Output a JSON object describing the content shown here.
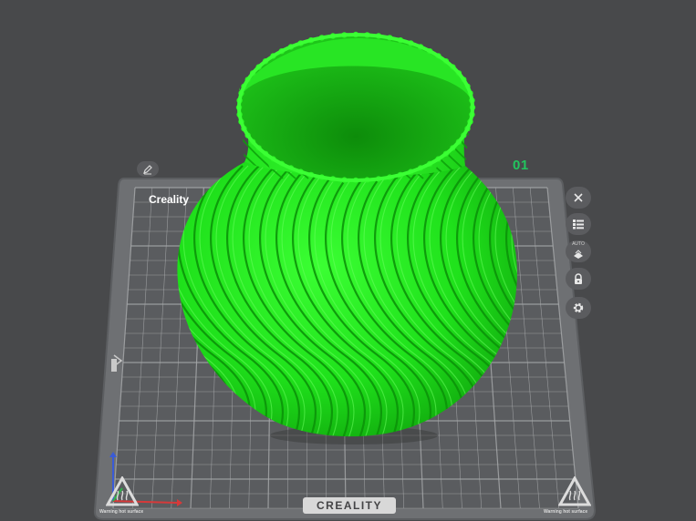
{
  "plate": {
    "brand_top": "Creality",
    "brand_bottom": "CREALITY",
    "number": "01",
    "warning_left": "Warning hot surface",
    "warning_right": "Warning hot surface"
  },
  "model": {
    "color": "#1ee81a",
    "shadow": "#0fa00c",
    "highlight": "#5cff4f"
  },
  "toolbar": {
    "buttons": [
      {
        "name": "close-icon"
      },
      {
        "name": "list-icon"
      },
      {
        "name": "auto-arrange-icon",
        "label": "AUTO"
      },
      {
        "name": "lock-icon"
      },
      {
        "name": "gear-icon"
      }
    ]
  },
  "colors": {
    "background": "#48494b",
    "plate": "#6e7073",
    "grid": "#a9abad",
    "accent": "#22c55e",
    "axis_x": "#d63a3a",
    "axis_y": "#2fb34a",
    "axis_z": "#3a5bd6"
  }
}
